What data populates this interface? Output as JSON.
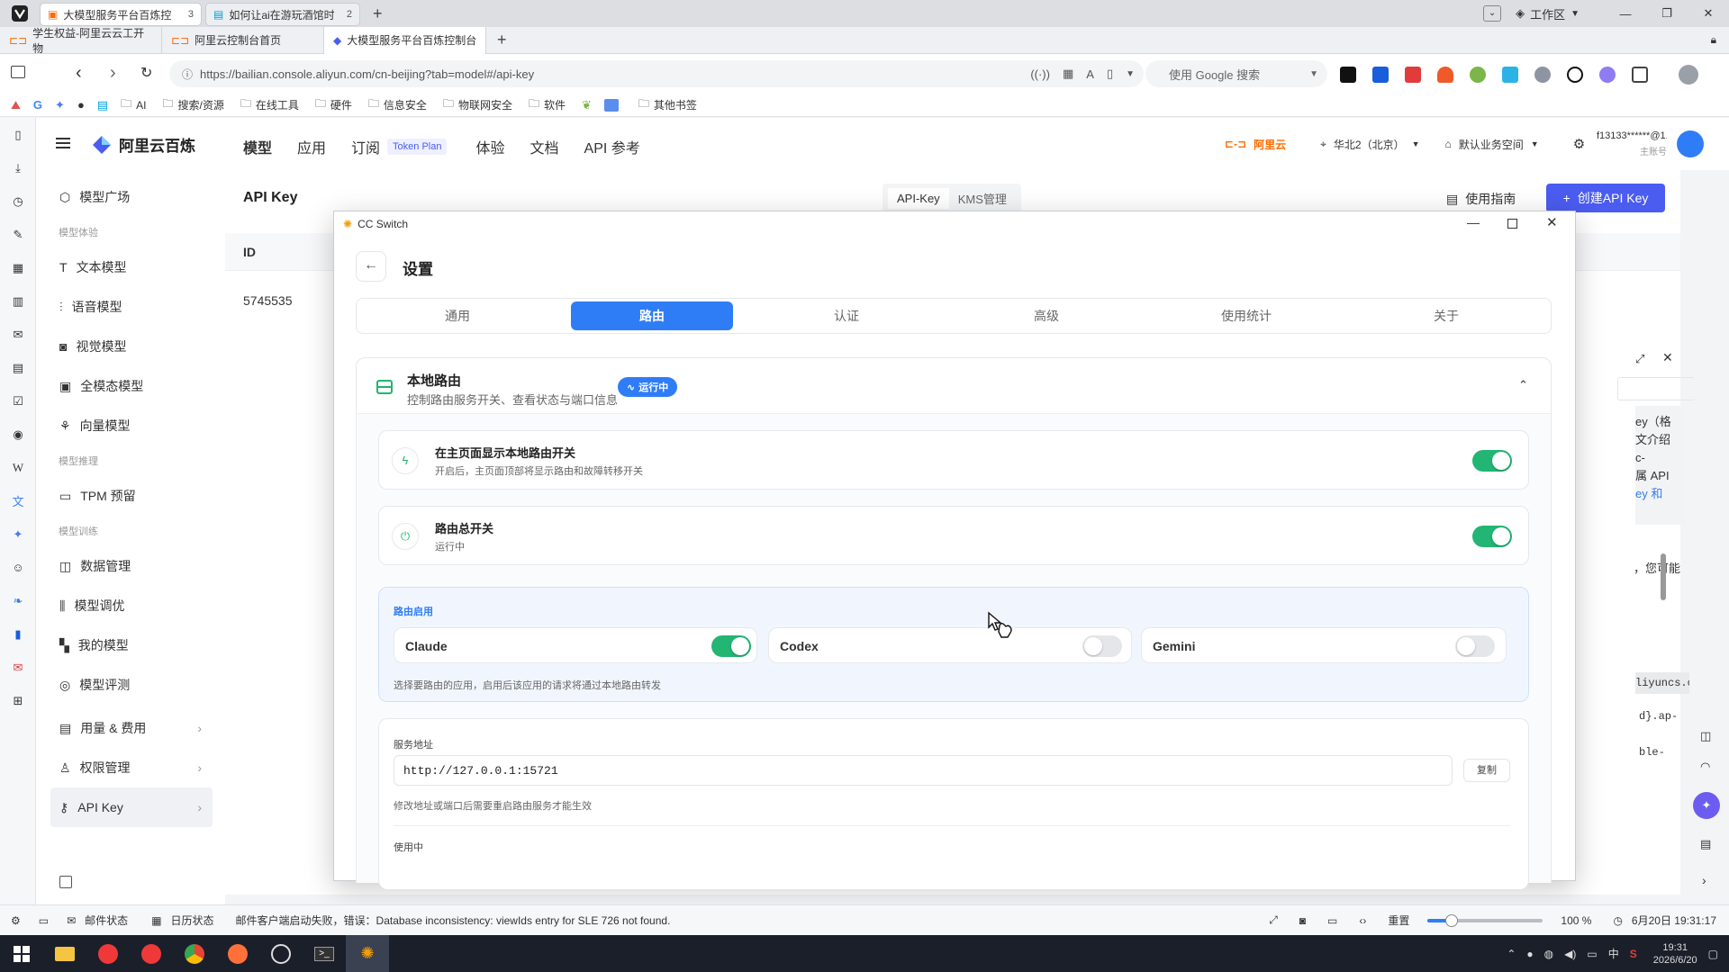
{
  "browser": {
    "tabs": [
      {
        "label": "大模型服务平台百炼控",
        "count": "3"
      },
      {
        "label": "如何让ai在游玩酒馆时",
        "count": "2"
      }
    ],
    "workspace_label": "工作区",
    "subtabs": [
      "学生权益-阿里云云工开物",
      "阿里云控制台首页",
      "大模型服务平台百炼控制台"
    ],
    "url": "https://bailian.console.aliyun.com/cn-beijing?tab=model#/api-key",
    "search_placeholder": "使用 Google 搜索",
    "bookmarks": [
      "AI",
      "搜索/资源",
      "在线工具",
      "硬件",
      "信息安全",
      "物联网安全",
      "软件",
      "其他书签"
    ]
  },
  "app": {
    "brand": "阿里云百炼",
    "nav": [
      "模型",
      "应用",
      "订阅",
      "体验",
      "文档",
      "API 参考"
    ],
    "token_plan_badge": "Token Plan",
    "aliyun_label": "阿里云",
    "region": "华北2（北京）",
    "workspace": "默认业务空间",
    "account": "f13133******@1...",
    "account_role": "主账号",
    "sidebar": {
      "top": "模型广场",
      "section1": "模型体验",
      "items1": [
        "文本模型",
        "语音模型",
        "视觉模型",
        "全模态模型",
        "向量模型"
      ],
      "section2": "模型推理",
      "items2": [
        "TPM 预留"
      ],
      "section3": "模型训练",
      "items3": [
        "数据管理",
        "模型调优",
        "我的模型",
        "模型评测"
      ],
      "bottom": [
        "用量 & 费用",
        "权限管理",
        "API Key"
      ]
    },
    "page": {
      "title": "API Key",
      "tab_apikey": "API-Key",
      "tab_kms": "KMS管理",
      "guide": "使用指南",
      "create": "创建API Key",
      "col_id": "ID",
      "row_id": "5745535"
    },
    "right_peek": {
      "lines": [
        "ey（格",
        "文介绍",
        "c-",
        "属 API",
        "ey 和"
      ],
      "extra": "，您可能",
      "code1": "liyuncs.c",
      "code2": "d}.ap-",
      "code3": "ble-"
    }
  },
  "dialog": {
    "window_title": "CC Switch",
    "title": "设置",
    "tabs": [
      "通用",
      "路由",
      "认证",
      "高级",
      "使用统计",
      "关于"
    ],
    "active_tab": 1,
    "section": {
      "title": "本地路由",
      "subtitle": "控制路由服务开关、查看状态与端口信息",
      "badge": "运行中"
    },
    "show_switch": {
      "title": "在主页面显示本地路由开关",
      "desc": "开启后，主页面顶部将显示路由和故障转移开关",
      "on": true
    },
    "master_switch": {
      "title": "路由总开关",
      "desc": "运行中",
      "on": true
    },
    "apps": {
      "label": "路由启用",
      "items": [
        {
          "name": "Claude",
          "on": true
        },
        {
          "name": "Codex",
          "on": false
        },
        {
          "name": "Gemini",
          "on": false
        }
      ],
      "hint": "选择要路由的应用，启用后该应用的请求将通过本地路由转发"
    },
    "service": {
      "label": "服务地址",
      "value": "http://127.0.0.1:15721",
      "copy": "复制",
      "hint": "修改地址或端口后需要重启路由服务才能生效",
      "in_use": "使用中"
    }
  },
  "statusbar": {
    "mail": "邮件状态",
    "calendar": "日历状态",
    "message": "邮件客户端启动失败，错误：Database inconsistency: viewIds entry for SLE 726 not found.",
    "reset": "重置",
    "zoom": "100 %",
    "datetime": "6月20日 19:31:17"
  },
  "taskbar": {
    "time": "19:31",
    "date": "2026/6/20",
    "ime": "中"
  },
  "colors": {
    "accent": "#2f7df6",
    "toggle_on": "#22b573",
    "create_button": "#4b5cf0"
  }
}
